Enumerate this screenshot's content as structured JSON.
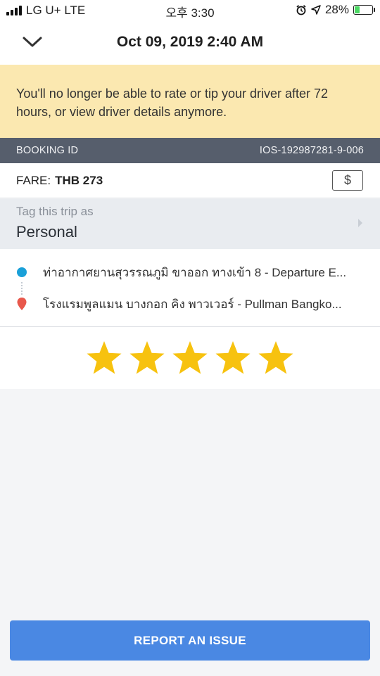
{
  "status_bar": {
    "carrier": "LG U+",
    "network": "LTE",
    "time": "오후 3:30",
    "battery_percent": "28%",
    "battery_level": 0.28,
    "icons": [
      "signal-icon",
      "alarm-icon",
      "location-arrow-icon",
      "battery-charging-icon"
    ]
  },
  "header": {
    "title": "Oct 09, 2019 2:40 AM",
    "back_icon": "chevron-down-icon"
  },
  "notice": {
    "text": "You'll no longer be able to rate or tip your driver after 72 hours, or view driver details anymore."
  },
  "booking": {
    "label": "BOOKING ID",
    "value": "IOS-192987281-9-006"
  },
  "fare": {
    "label": "FARE:",
    "value": "THB 273",
    "payment_icon": "dollar-icon",
    "payment_symbol": "$"
  },
  "tag": {
    "label": "Tag this trip as",
    "value": "Personal"
  },
  "route": {
    "pickup": "ท่าอากาศยานสุวรรณภูมิ ขาออก ทางเข้า 8 - Departure E...",
    "dropoff": "โรงแรมพูลแมน บางกอก คิง พาวเวอร์ - Pullman Bangko..."
  },
  "rating": {
    "stars": 5,
    "max": 5
  },
  "actions": {
    "report_label": "REPORT AN ISSUE"
  },
  "colors": {
    "notice_bg": "#fbe8b0",
    "booking_bar": "#565e6c",
    "star": "#f7c20f",
    "pickup": "#1aa0d8",
    "dropoff": "#e8584c",
    "button": "#4a88e3"
  }
}
